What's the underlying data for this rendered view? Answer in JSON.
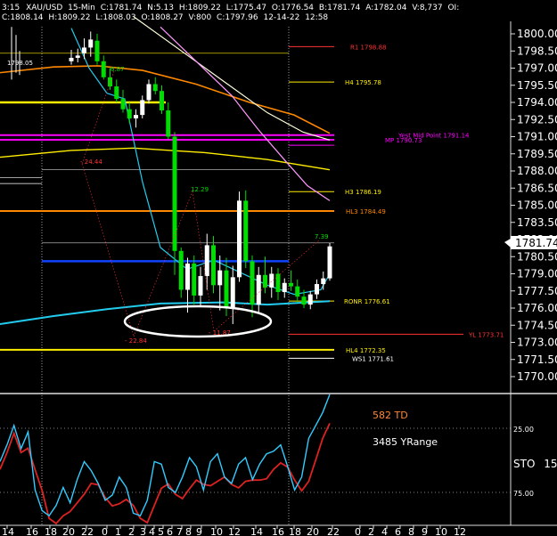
{
  "header": {
    "time_fragment": "3:15",
    "symbol": "XAU/USD",
    "interval": "15-Min",
    "close": "C:1781.74",
    "net": "N:5.13",
    "high": "H:1781.82",
    "low": "L:1775.47",
    "open": "O:1776.54",
    "bid": "B:1781.74",
    "ask": "A:1782.04",
    "volume": "V:8,737",
    "oi": "OI:",
    "prev": "C:1808.14",
    "prev_high": "H:1809.22",
    "prev_low": "L:1808.03",
    "prev_open": "O:1808.27",
    "prev_vol": "V:800",
    "prev_close2": "C:1797.96",
    "date": "12-14-22",
    "time": "12:58"
  },
  "colors": {
    "background": "#000000",
    "candle": "#ffffff",
    "candle_alt": "#00dd00",
    "pivot_red": "#ff3333",
    "pivot_yellow": "#ffee00",
    "magenta": "#ff00ff",
    "orange_ma": "#ff8800",
    "cyan_ma": "#22ccee",
    "blue_line": "#1144ff",
    "sto_red": "#dd2222",
    "sto_cyan": "#33ccff"
  },
  "chart_data": {
    "type": "candlestick",
    "ylim": [
      1769.5,
      1801.5
    ],
    "y_ticks": [
      "1800.00",
      "1798.50",
      "1797.00",
      "1795.50",
      "1794.00",
      "1792.50",
      "1791.00",
      "1789.50",
      "1788.00",
      "1786.50",
      "1785.00",
      "1783.50",
      "1782.00",
      "1780.50",
      "1779.00",
      "1777.50",
      "1776.00",
      "1774.50",
      "1773.00",
      "1771.50",
      "1770.00"
    ],
    "y_tick_values": [
      1800.0,
      1798.5,
      1797.0,
      1795.5,
      1794.0,
      1792.5,
      1791.0,
      1789.5,
      1788.0,
      1786.5,
      1785.0,
      1783.5,
      1782.0,
      1780.5,
      1779.0,
      1777.5,
      1776.0,
      1774.5,
      1773.0,
      1771.5,
      1770.0
    ],
    "last_price": "1781.74",
    "x_ticks": [
      "14",
      "16",
      "18",
      "20",
      "22",
      "0",
      "1",
      "2",
      "3",
      "4",
      "5",
      "6",
      "7",
      "8",
      "9",
      "10",
      "12",
      "14",
      "16",
      "18",
      "20",
      "22",
      "0",
      "2",
      "4",
      "6",
      "8",
      "9",
      "10",
      "12"
    ],
    "levels": [
      {
        "label": "R1 1798.88",
        "value": 1798.88,
        "color": "#ff3333"
      },
      {
        "label": "H4 1795.78",
        "value": 1795.78,
        "color": "#ffee00"
      },
      {
        "label": "Yest Mid Point 1791.14",
        "value": 1791.14,
        "color": "#ff00ff"
      },
      {
        "label": "MP 1790.73",
        "value": 1790.73,
        "color": "#ff00ff"
      },
      {
        "label": "H3 1786.19",
        "value": 1786.19,
        "color": "#ffee00"
      },
      {
        "label": "HL3 1784.49",
        "value": 1784.49,
        "color": "#ff8800"
      },
      {
        "label": "RONR 1776.61",
        "value": 1776.61,
        "color": "#ffee00"
      },
      {
        "label": "YL 1773.71",
        "value": 1773.71,
        "color": "#ff3333"
      },
      {
        "label": "HL4 1772.35",
        "value": 1772.35,
        "color": "#ffee00"
      },
      {
        "label": "WS1 1771.61",
        "value": 1771.61,
        "color": "#ffffff"
      }
    ],
    "swing_labels": [
      "1798.05",
      "6.87",
      "- 24.44",
      "12.29",
      "7.39",
      "- 22.84",
      "- 11.87"
    ],
    "candles": [
      [
        1797.6,
        1798.6,
        1797.3,
        1797.9
      ],
      [
        1797.9,
        1798.7,
        1797.5,
        1798.1
      ],
      [
        1798.3,
        1799.6,
        1797.8,
        1798.8
      ],
      [
        1798.8,
        1800.2,
        1798.0,
        1799.5
      ],
      [
        1799.4,
        1800.0,
        1797.3,
        1797.6
      ],
      [
        1797.6,
        1798.1,
        1796.0,
        1796.2
      ],
      [
        1796.2,
        1797.0,
        1795.1,
        1795.4
      ],
      [
        1795.4,
        1796.0,
        1794.0,
        1794.3
      ],
      [
        1794.3,
        1795.1,
        1793.1,
        1793.4
      ],
      [
        1793.4,
        1794.0,
        1792.2,
        1792.6
      ],
      [
        1792.6,
        1793.4,
        1791.8,
        1792.9
      ],
      [
        1792.9,
        1794.6,
        1792.6,
        1794.2
      ],
      [
        1794.2,
        1796.0,
        1793.9,
        1795.6
      ],
      [
        1795.6,
        1796.2,
        1794.7,
        1795.0
      ],
      [
        1795.0,
        1795.5,
        1793.0,
        1793.3
      ],
      [
        1793.3,
        1794.0,
        1790.8,
        1791.0
      ],
      [
        1791.0,
        1791.4,
        1778.9,
        1781.0
      ],
      [
        1781.0,
        1781.3,
        1776.9,
        1777.6
      ],
      [
        1777.6,
        1780.4,
        1775.6,
        1779.9
      ],
      [
        1779.9,
        1780.6,
        1776.3,
        1777.1
      ],
      [
        1777.1,
        1779.6,
        1776.2,
        1778.8
      ],
      [
        1778.8,
        1782.5,
        1777.6,
        1781.5
      ],
      [
        1781.5,
        1782.3,
        1777.3,
        1778.0
      ],
      [
        1778.0,
        1780.6,
        1775.8,
        1779.3
      ],
      [
        1779.3,
        1780.4,
        1775.3,
        1776.0
      ],
      [
        1776.0,
        1779.7,
        1774.6,
        1778.7
      ],
      [
        1778.7,
        1786.2,
        1778.3,
        1785.4
      ],
      [
        1785.4,
        1786.3,
        1779.5,
        1780.1
      ],
      [
        1780.1,
        1780.6,
        1775.2,
        1776.3
      ],
      [
        1776.3,
        1779.6,
        1775.6,
        1778.9
      ],
      [
        1778.9,
        1780.5,
        1777.3,
        1777.8
      ],
      [
        1777.8,
        1779.6,
        1776.9,
        1779.0
      ],
      [
        1779.0,
        1779.5,
        1776.7,
        1777.4
      ],
      [
        1777.4,
        1778.6,
        1776.9,
        1778.2
      ],
      [
        1778.2,
        1779.3,
        1777.5,
        1777.9
      ],
      [
        1777.9,
        1778.5,
        1776.5,
        1777.0
      ],
      [
        1777.0,
        1777.6,
        1776.0,
        1776.3
      ],
      [
        1776.3,
        1777.5,
        1775.9,
        1777.2
      ],
      [
        1777.2,
        1778.5,
        1776.8,
        1778.1
      ],
      [
        1778.1,
        1779.2,
        1777.6,
        1778.6
      ],
      [
        1778.6,
        1781.7,
        1778.4,
        1781.4
      ]
    ]
  },
  "indicator": {
    "td_label": "582 TD",
    "yrange_label": "3485 YRange",
    "sto_label": "STO",
    "sto_value": "15,",
    "ticks": [
      "25.00",
      "75.00"
    ]
  }
}
